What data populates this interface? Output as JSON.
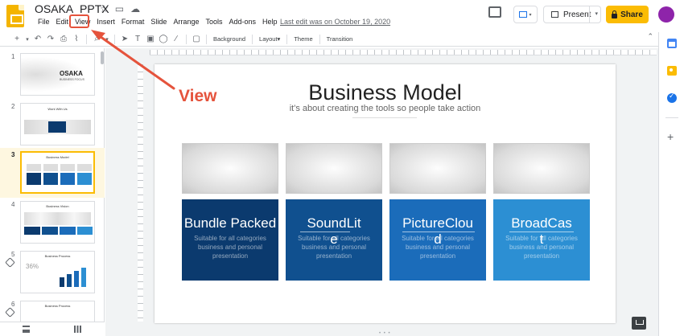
{
  "header": {
    "title": "OSAKA_PPTX",
    "menu": [
      "File",
      "Edit",
      "View",
      "Insert",
      "Format",
      "Slide",
      "Arrange",
      "Tools",
      "Add-ons",
      "Help"
    ],
    "last_edit": "Last edit was on October 19, 2020",
    "present_label": "Present",
    "share_label": "Share"
  },
  "toolbar": {
    "background_label": "Background",
    "layout_label": "Layout▾",
    "theme_label": "Theme",
    "transition_label": "Transition"
  },
  "filmstrip": {
    "slides": [
      {
        "number": "1",
        "caption": "OSAKA",
        "subcaption": "BUSINESS FOCUS"
      },
      {
        "number": "2",
        "caption": "Work With Us"
      },
      {
        "number": "3",
        "caption": "Business Model"
      },
      {
        "number": "4",
        "caption": "Business Vision"
      },
      {
        "number": "5",
        "caption": "Business Process",
        "stat": "36%"
      },
      {
        "number": "6",
        "caption": "Business Process"
      }
    ]
  },
  "slide": {
    "title": "Business Model",
    "subtitle": "it's about creating the tools so people take action",
    "cards": [
      {
        "title": "Bundle Packed",
        "wrap": "",
        "desc": "Suitable for all categories business and personal presentation",
        "color": "#0b3a6e"
      },
      {
        "title": "SoundLit",
        "wrap": "e",
        "desc": "Suitable for all categories business and personal presentation",
        "color": "#10508f"
      },
      {
        "title": "PictureClou",
        "wrap": "d",
        "desc": "Suitable for all categories business and personal presentation",
        "color": "#1b6cba"
      },
      {
        "title": "BroadCas",
        "wrap": "t",
        "desc": "Suitable for all categories business and personal presentation",
        "color": "#2c8fd3"
      }
    ]
  },
  "annotation": {
    "label": "View",
    "color": "#e5533c"
  }
}
